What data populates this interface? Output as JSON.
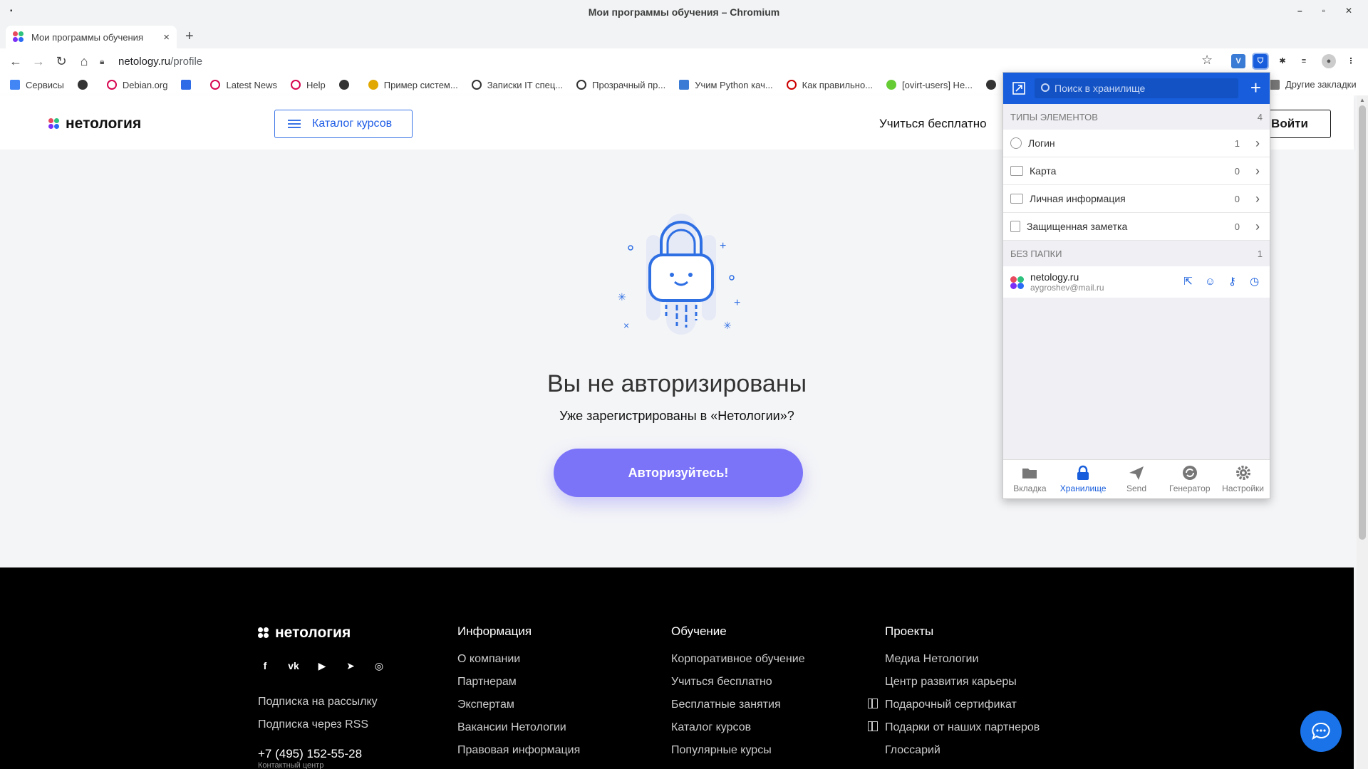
{
  "window": {
    "title": "Мои программы обучения – Chromium"
  },
  "tab": {
    "title": "Мои программы обучения",
    "close": "×",
    "new": "+"
  },
  "toolbar": {
    "url_host": "netology.ru",
    "url_path": "/profile"
  },
  "bookmarks": [
    {
      "label": "Сервисы",
      "color": "#4285f4"
    },
    {
      "label": "",
      "color": "#333"
    },
    {
      "label": "Debian.org",
      "color": "#d70751"
    },
    {
      "label": "",
      "color": "#2e6be6"
    },
    {
      "label": "Latest News",
      "color": "#d70751"
    },
    {
      "label": "Help",
      "color": "#d70751"
    },
    {
      "label": "",
      "color": "#333"
    },
    {
      "label": "Пример систем...",
      "color": "#e0a800"
    },
    {
      "label": "Записки IT спец...",
      "color": "#333"
    },
    {
      "label": "Прозрачный пр...",
      "color": "#333"
    },
    {
      "label": "Учим Python кач...",
      "color": "#3a7bd5"
    },
    {
      "label": "Как правильно...",
      "color": "#c00"
    },
    {
      "label": "[ovirt-users] He...",
      "color": "#6c3"
    },
    {
      "label": "",
      "color": "#333"
    }
  ],
  "bookmarks_other": "Другие закладки",
  "site": {
    "logo": "нетология",
    "catalog": "Каталог курсов",
    "learn_free": "Учиться бесплатно",
    "login": "Войти",
    "title": "Вы не авторизированы",
    "subtitle": "Уже зарегистрированы в «Нетологии»?",
    "auth_button": "Авторизуйтесь!"
  },
  "footer": {
    "logo": "нетология",
    "socials": [
      "f",
      "vk",
      "▶",
      "➤",
      "◎"
    ],
    "left_links": [
      "Подписка на рассылку",
      "Подписка через RSS"
    ],
    "phone": "+7 (495) 152-55-28",
    "phone_caption": "Контактный центр",
    "columns": [
      {
        "heading": "Информация",
        "links": [
          "О компании",
          "Партнерам",
          "Экспертам",
          "Вакансии Нетологии",
          "Правовая информация"
        ]
      },
      {
        "heading": "Обучение",
        "links": [
          "Корпоративное обучение",
          "Учиться бесплатно",
          "Бесплатные занятия",
          "Каталог курсов",
          "Популярные курсы"
        ]
      },
      {
        "heading": "Проекты",
        "links": [
          "Медиа Нетологии",
          "Центр развития карьеры",
          "Подарочный сертификат",
          "Подарки от наших партнеров",
          "Глоссарий"
        ]
      }
    ]
  },
  "bitwarden": {
    "search_placeholder": "Поиск в хранилище",
    "types_header": "Типы элементов",
    "types_count": "4",
    "types": [
      {
        "label": "Логин",
        "count": "1",
        "icon": "globe-icon"
      },
      {
        "label": "Карта",
        "count": "0",
        "icon": "card-icon"
      },
      {
        "label": "Личная информация",
        "count": "0",
        "icon": "id-card-icon"
      },
      {
        "label": "Защищенная заметка",
        "count": "0",
        "icon": "note-icon"
      }
    ],
    "nofolder_header": "Без папки",
    "nofolder_count": "1",
    "item": {
      "name": "netology.ru",
      "user": "aygroshev@mail.ru"
    },
    "tabs": [
      {
        "label": "Вкладка",
        "active": false
      },
      {
        "label": "Хранилище",
        "active": true
      },
      {
        "label": "Send",
        "active": false
      },
      {
        "label": "Генератор",
        "active": false
      },
      {
        "label": "Настройки",
        "active": false
      }
    ]
  }
}
